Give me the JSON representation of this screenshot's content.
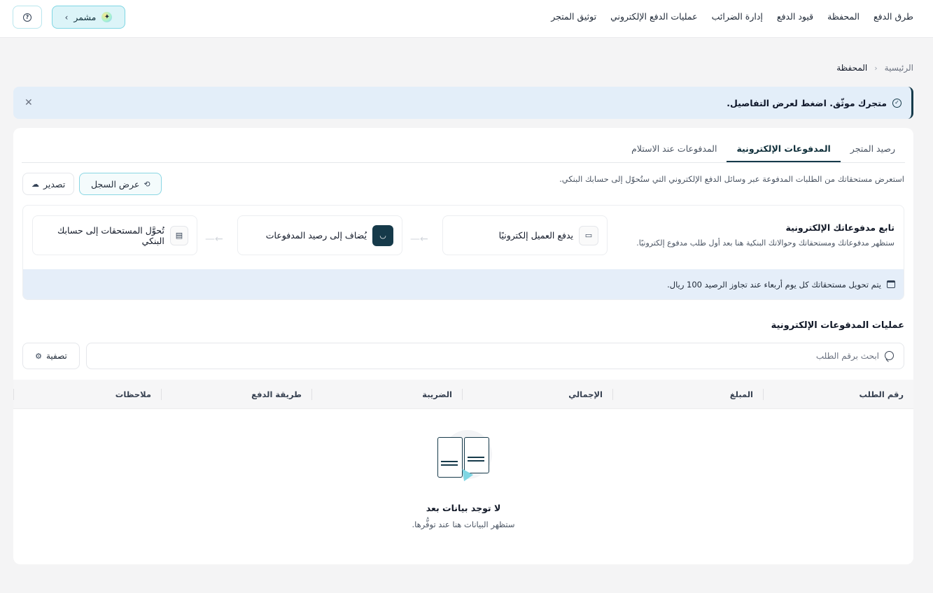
{
  "topnav": {
    "items": [
      "طرق الدفع",
      "المحفظة",
      "قيود الدفع",
      "إدارة الضرائب",
      "عمليات الدفع الإلكتروني",
      "توثيق المتجر"
    ]
  },
  "user_chip": {
    "label": "مشمر"
  },
  "breadcrumb": {
    "home": "الرئيسية",
    "current": "المحفظة"
  },
  "alert": {
    "message": "متجرك موثّق. اضغط لعرض التفاصيل."
  },
  "tabs": [
    "رصيد المتجر",
    "المدفوعات الإلكترونية",
    "المدفوعات عند الاستلام"
  ],
  "active_tab": "المدفوعات الإلكترونية",
  "description": "استعرض مستحقاتك من الطلبات المدفوعة عبر وسائل الدفع الإلكتروني التي ستُحوّل إلى حسابك البنكي.",
  "actions": {
    "history": "عرض السجل",
    "export": "تصدير"
  },
  "tracker": {
    "title": "تابع مدفوعاتك الإلكترونية",
    "subtitle": "ستظهر مدفوعاتك ومستحقاتك وحوالاتك البنكية هنا بعد أول طلب مدفوع إلكترونيًا.",
    "steps": [
      "يدفع العميل إلكترونيًا",
      "يُضاف إلى رصيد المدفوعات",
      "تُحوَّل المستحقات إلى حسابك البنكي"
    ],
    "note": "يتم تحويل مستحقاتك كل يوم أربعاء عند تجاوز الرصيد 100 ريال."
  },
  "operations": {
    "title": "عمليات المدفوعات الإلكترونية",
    "search_placeholder": "ابحث برقم الطلب",
    "filter": "تصفية"
  },
  "table": {
    "columns": [
      "رقم الطلب",
      "المبلغ",
      "الإجمالي",
      "الضريبة",
      "طريقة الدفع",
      "ملاحظات"
    ]
  },
  "empty": {
    "title": "لا توجد بيانات بعد",
    "subtitle": "ستظهر البيانات هنا عند توفُّرها."
  },
  "colors": {
    "brand": "#163a4a",
    "accent": "#7fd6e3",
    "info_bg": "#e3eef9"
  }
}
